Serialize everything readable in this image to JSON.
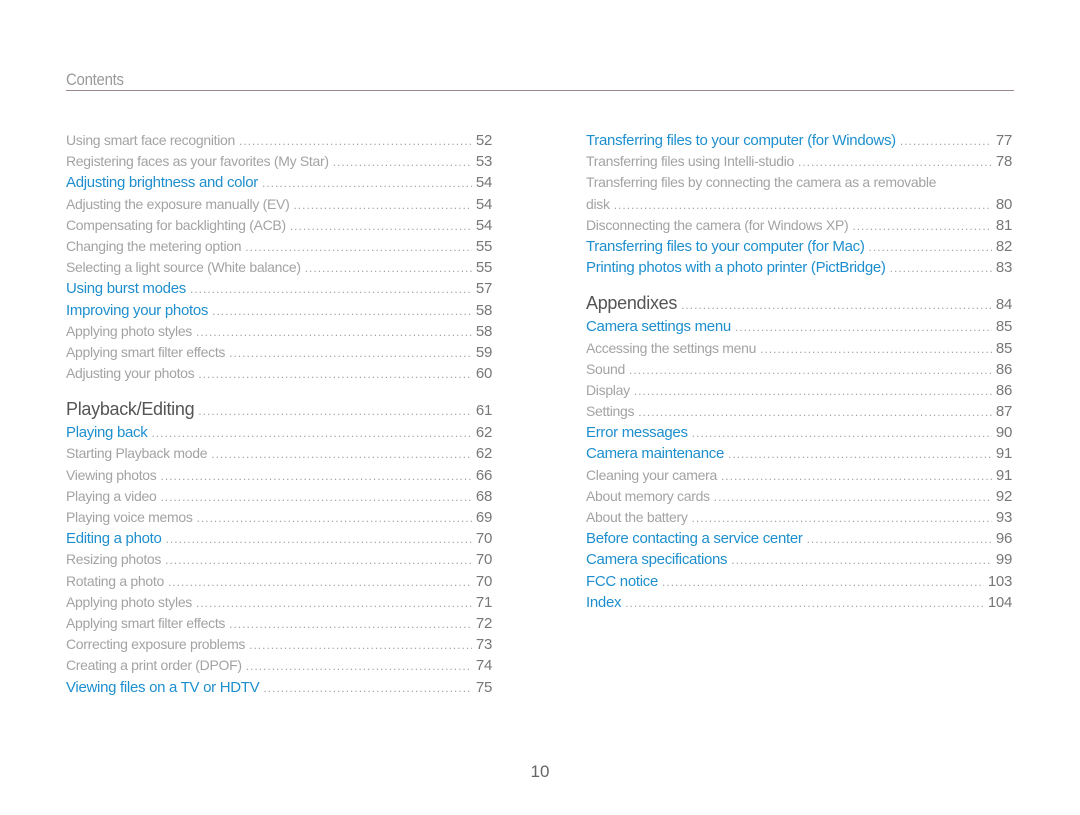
{
  "header": {
    "title": "Contents"
  },
  "left_column": [
    {
      "level": 2,
      "text": "Using smart face recognition",
      "page": "52"
    },
    {
      "level": 2,
      "text": "Registering faces as your favorites (My Star)",
      "page": "53"
    },
    {
      "level": 1,
      "text": "Adjusting brightness and color",
      "page": "54"
    },
    {
      "level": 2,
      "text": "Adjusting the exposure manually (EV)",
      "page": "54"
    },
    {
      "level": 2,
      "text": "Compensating for backlighting (ACB)",
      "page": "54"
    },
    {
      "level": 2,
      "text": "Changing the metering option",
      "page": "55"
    },
    {
      "level": 2,
      "text": "Selecting a light source (White balance)",
      "page": "55"
    },
    {
      "level": 1,
      "text": "Using burst modes",
      "page": "57"
    },
    {
      "level": 1,
      "text": "Improving your photos",
      "page": "58"
    },
    {
      "level": 2,
      "text": "Applying photo styles",
      "page": "58"
    },
    {
      "level": 2,
      "text": "Applying smart filter effects",
      "page": "59"
    },
    {
      "level": 2,
      "text": "Adjusting your photos",
      "page": "60"
    },
    {
      "level": 0,
      "text": "Playback/Editing",
      "page": "61"
    },
    {
      "level": 1,
      "text": "Playing back",
      "page": "62"
    },
    {
      "level": 2,
      "text": "Starting Playback mode",
      "page": "62"
    },
    {
      "level": 2,
      "text": "Viewing photos",
      "page": "66"
    },
    {
      "level": 2,
      "text": "Playing a video",
      "page": "68"
    },
    {
      "level": 2,
      "text": "Playing voice memos",
      "page": "69"
    },
    {
      "level": 1,
      "text": "Editing a photo",
      "page": "70"
    },
    {
      "level": 2,
      "text": "Resizing photos",
      "page": "70"
    },
    {
      "level": 2,
      "text": "Rotating a photo",
      "page": "70"
    },
    {
      "level": 2,
      "text": "Applying photo styles",
      "page": "71"
    },
    {
      "level": 2,
      "text": "Applying smart filter effects",
      "page": "72"
    },
    {
      "level": 2,
      "text": "Correcting exposure problems",
      "page": "73"
    },
    {
      "level": 2,
      "text": "Creating a print order (DPOF)",
      "page": "74"
    },
    {
      "level": 1,
      "text": "Viewing files on a TV or HDTV",
      "page": "75"
    }
  ],
  "right_column": [
    {
      "level": 1,
      "text": "Transferring files to your computer (for Windows)",
      "page": "77"
    },
    {
      "level": 2,
      "text": "Transferring files using Intelli-studio",
      "page": "78"
    },
    {
      "level": 2,
      "text": "Transferring files by connecting the camera as a removable",
      "page": "",
      "wrap": true
    },
    {
      "level": 2,
      "text": "disk",
      "page": "80"
    },
    {
      "level": 2,
      "text": "Disconnecting the camera (for Windows XP)",
      "page": "81"
    },
    {
      "level": 1,
      "text": "Transferring files to your computer (for Mac)",
      "page": "82"
    },
    {
      "level": 1,
      "text": "Printing photos with a photo printer (PictBridge)",
      "page": "83"
    },
    {
      "level": 0,
      "text": "Appendixes",
      "page": "84"
    },
    {
      "level": 1,
      "text": "Camera settings menu",
      "page": "85"
    },
    {
      "level": 2,
      "text": "Accessing the settings menu",
      "page": "85"
    },
    {
      "level": 2,
      "text": "Sound",
      "page": "86"
    },
    {
      "level": 2,
      "text": "Display",
      "page": "86"
    },
    {
      "level": 2,
      "text": "Settings",
      "page": "87"
    },
    {
      "level": 1,
      "text": "Error messages",
      "page": "90"
    },
    {
      "level": 1,
      "text": "Camera maintenance",
      "page": "91"
    },
    {
      "level": 2,
      "text": "Cleaning your camera",
      "page": "91"
    },
    {
      "level": 2,
      "text": "About memory cards",
      "page": "92"
    },
    {
      "level": 2,
      "text": "About the battery",
      "page": "93"
    },
    {
      "level": 1,
      "text": "Before contacting a service center",
      "page": "96"
    },
    {
      "level": 1,
      "text": "Camera specifications",
      "page": "99"
    },
    {
      "level": 1,
      "text": "FCC notice",
      "page": "103"
    },
    {
      "level": 1,
      "text": "Index",
      "page": "104"
    }
  ],
  "footer": {
    "page_number": "10"
  },
  "colors": {
    "link_blue": "#1e8fce",
    "sub_gray": "#a3a3a3",
    "heading_gray": "#555555",
    "rule": "#9a8a8a"
  }
}
